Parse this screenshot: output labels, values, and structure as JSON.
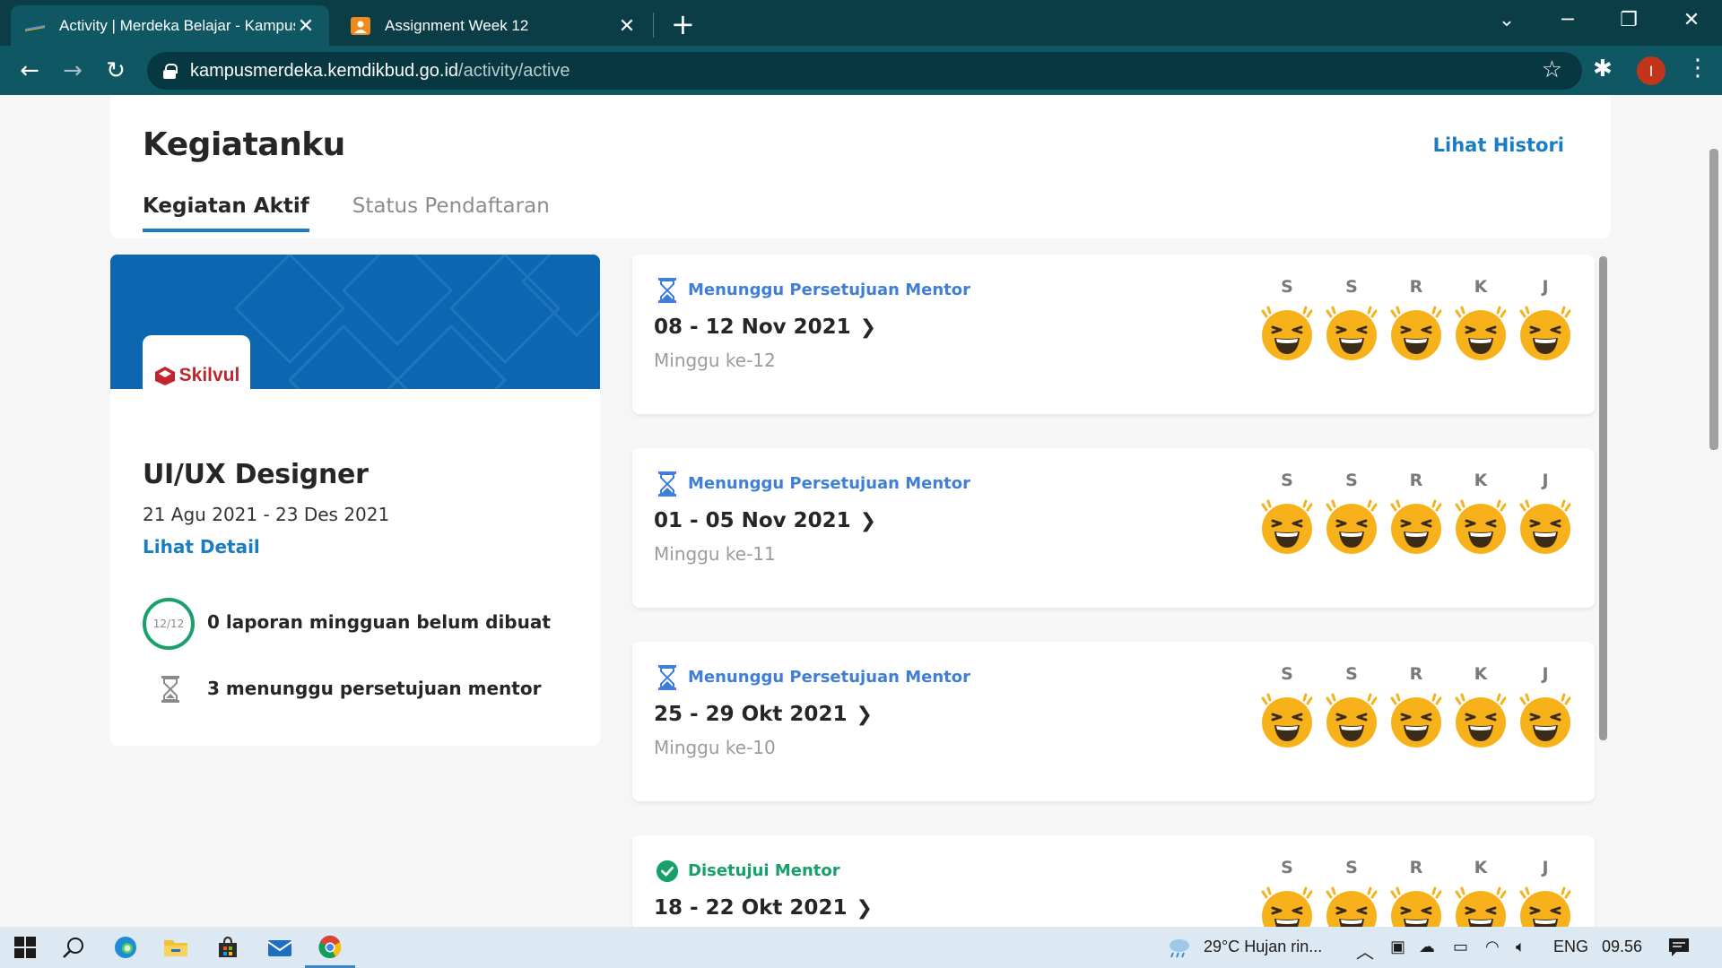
{
  "browser": {
    "tabs": [
      {
        "title": "Activity | Merdeka Belajar - Kampus Merdeka",
        "active": true
      },
      {
        "title": "Assignment Week 12",
        "active": false
      }
    ],
    "url_host": "kampusmerdeka.kemdikbud.go.id",
    "url_path": "/activity/active",
    "profile_initial": "I"
  },
  "page": {
    "title": "Kegiatanku",
    "history_link": "Lihat Histori",
    "tabs": [
      {
        "label": "Kegiatan Aktif",
        "active": true
      },
      {
        "label": "Status Pendaftaran",
        "active": false
      }
    ]
  },
  "program": {
    "logo_text": "Skilvul",
    "title": "UI/UX Designer",
    "dates": "21 Agu 2021 - 23 Des 2021",
    "detail_link": "Lihat Detail",
    "progress_ring": "12/12",
    "progress_fraction": 1.0,
    "stat_reports": "0 laporan mingguan belum dibuat",
    "stat_pending": "3 menunggu persetujuan mentor"
  },
  "weeks": [
    {
      "status": "Menunggu Persetujuan Mentor",
      "status_type": "pending",
      "range": "08 - 12 Nov 2021",
      "label": "Minggu ke-12"
    },
    {
      "status": "Menunggu Persetujuan Mentor",
      "status_type": "pending",
      "range": "01 - 05 Nov 2021",
      "label": "Minggu ke-11"
    },
    {
      "status": "Menunggu Persetujuan Mentor",
      "status_type": "pending",
      "range": "25 - 29 Okt 2021",
      "label": "Minggu ke-10"
    },
    {
      "status": "Disetujui Mentor",
      "status_type": "approved",
      "range": "18 - 22 Okt 2021",
      "label": ""
    }
  ],
  "day_letters": [
    "S",
    "S",
    "R",
    "K",
    "J"
  ],
  "colors": {
    "accent": "#1a7dc1",
    "pending": "#3f7fd6",
    "approved": "#17a06a",
    "emoji": "#f7b21b"
  },
  "taskbar": {
    "weather": "29°C  Hujan rin...",
    "lang": "ENG",
    "time": "09.56"
  }
}
